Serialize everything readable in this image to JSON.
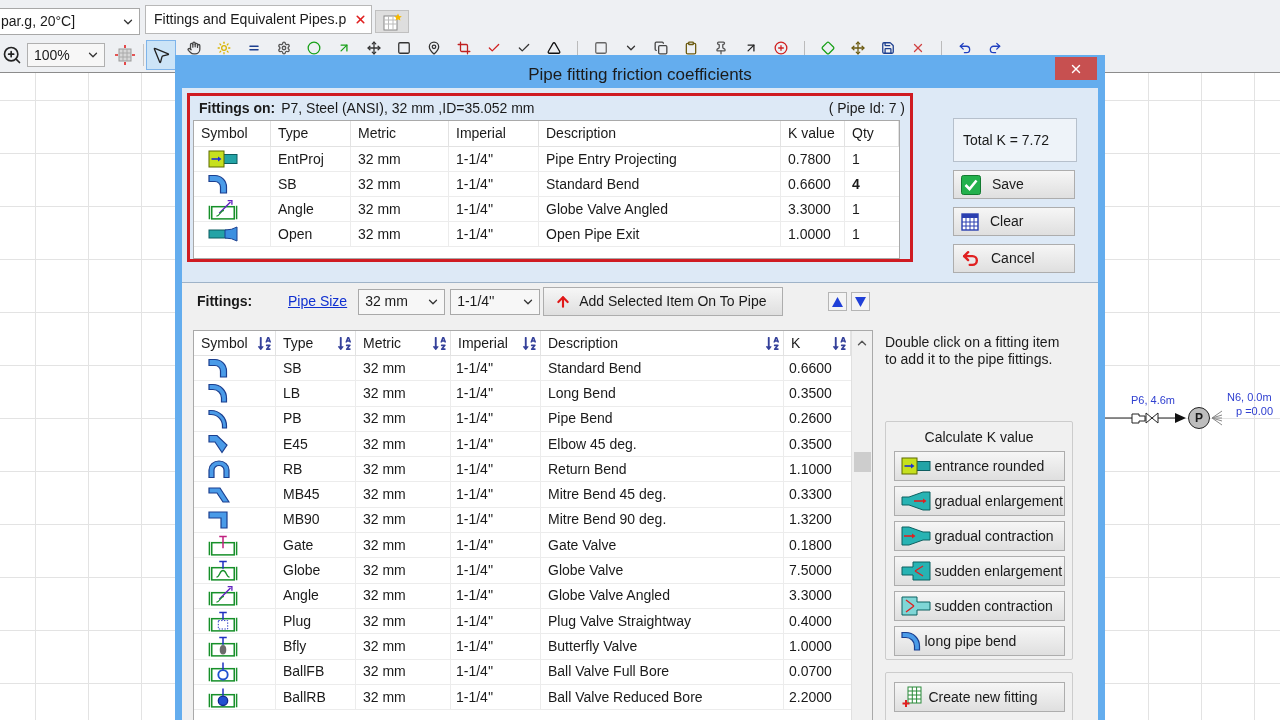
{
  "app": {
    "unit_dropdown": "par.g, 20°C]",
    "tabs": [
      {
        "label": "Fittings and Equivalent Pipes.p",
        "selected": true
      }
    ],
    "zoom": "100%",
    "pointer_tool": {
      "selected": true
    }
  },
  "dialog": {
    "title": "Pipe fitting friction coefficients",
    "pipe_fittings": {
      "label": "Fittings on:",
      "pipe": "P7, Steel (ANSI), 32 mm ,ID=35.052 mm",
      "pipe_id": "( Pipe Id: 7 )",
      "columns": [
        "Symbol",
        "Type",
        "Metric",
        "Imperial",
        "Description",
        "K value",
        "Qty"
      ],
      "rows": [
        {
          "type": "EntProj",
          "metric": "32 mm",
          "imperial": "1-1/4''",
          "description": "Pipe Entry Projecting",
          "k_value": "0.7800",
          "qty": "1",
          "qty_modified": false
        },
        {
          "type": "SB",
          "metric": "32 mm",
          "imperial": "1-1/4''",
          "description": "Standard Bend",
          "k_value": "0.6600",
          "qty": "4",
          "qty_modified": true
        },
        {
          "type": "Angle",
          "metric": "32 mm",
          "imperial": "1-1/4''",
          "description": "Globe Valve Angled",
          "k_value": "3.3000",
          "qty": "1",
          "qty_modified": false
        },
        {
          "type": "Open",
          "metric": "32 mm",
          "imperial": "1-1/4''",
          "description": "Open Pipe Exit",
          "k_value": "1.0000",
          "qty": "1",
          "qty_modified": false
        }
      ]
    },
    "total_k": "Total K = 7.72",
    "actions": [
      "Save",
      "Clear",
      "Cancel"
    ],
    "fittings_bar": {
      "label": "Fittings:",
      "link": "Pipe Size",
      "metric_size": "32 mm",
      "imperial_size": "1-1/4''",
      "add_button": "Add Selected Item On To Pipe"
    },
    "catalog": {
      "columns": [
        "Symbol",
        "Type",
        "Metric",
        "Imperial",
        "Description",
        "K"
      ],
      "rows": [
        {
          "type": "SB",
          "metric": "32 mm",
          "imperial": "1-1/4''",
          "description": "Standard Bend",
          "k": "0.6600"
        },
        {
          "type": "LB",
          "metric": "32 mm",
          "imperial": "1-1/4''",
          "description": "Long Bend",
          "k": "0.3500"
        },
        {
          "type": "PB",
          "metric": "32 mm",
          "imperial": "1-1/4''",
          "description": "Pipe Bend",
          "k": "0.2600"
        },
        {
          "type": "E45",
          "metric": "32 mm",
          "imperial": "1-1/4''",
          "description": "Elbow 45 deg.",
          "k": "0.3500"
        },
        {
          "type": "RB",
          "metric": "32 mm",
          "imperial": "1-1/4''",
          "description": "Return Bend",
          "k": "1.1000"
        },
        {
          "type": "MB45",
          "metric": "32 mm",
          "imperial": "1-1/4''",
          "description": "Mitre Bend 45 deg.",
          "k": "0.3300"
        },
        {
          "type": "MB90",
          "metric": "32 mm",
          "imperial": "1-1/4''",
          "description": "Mitre Bend 90 deg.",
          "k": "1.3200"
        },
        {
          "type": "Gate",
          "metric": "32 mm",
          "imperial": "1-1/4''",
          "description": "Gate Valve",
          "k": "0.1800"
        },
        {
          "type": "Globe",
          "metric": "32 mm",
          "imperial": "1-1/4''",
          "description": "Globe Valve",
          "k": "7.5000"
        },
        {
          "type": "Angle",
          "metric": "32 mm",
          "imperial": "1-1/4''",
          "description": "Globe Valve Angled",
          "k": "3.3000"
        },
        {
          "type": "Plug",
          "metric": "32 mm",
          "imperial": "1-1/4''",
          "description": "Plug Valve Straightway",
          "k": "0.4000"
        },
        {
          "type": "Bfly",
          "metric": "32 mm",
          "imperial": "1-1/4''",
          "description": "Butterfly Valve",
          "k": "1.0000"
        },
        {
          "type": "BallFB",
          "metric": "32 mm",
          "imperial": "1-1/4''",
          "description": "Ball Valve Full Bore",
          "k": "0.0700"
        },
        {
          "type": "BallRB",
          "metric": "32 mm",
          "imperial": "1-1/4''",
          "description": "Ball Valve Reduced Bore",
          "k": "2.2000"
        }
      ]
    },
    "hint": "Double click on a fitting item to add it to the pipe fittings.",
    "calculate": {
      "title": "Calculate K value",
      "buttons": [
        "entrance rounded",
        "gradual enlargement",
        "gradual contraction",
        "sudden enlargement",
        "sudden contraction",
        "long pipe bend"
      ]
    },
    "create_button": "Create new fitting"
  },
  "diagram": {
    "pipe_label": "P6, 4.6m",
    "node_label": "N6, 0.0m",
    "pressure": "p =0.00",
    "pump": "P"
  }
}
